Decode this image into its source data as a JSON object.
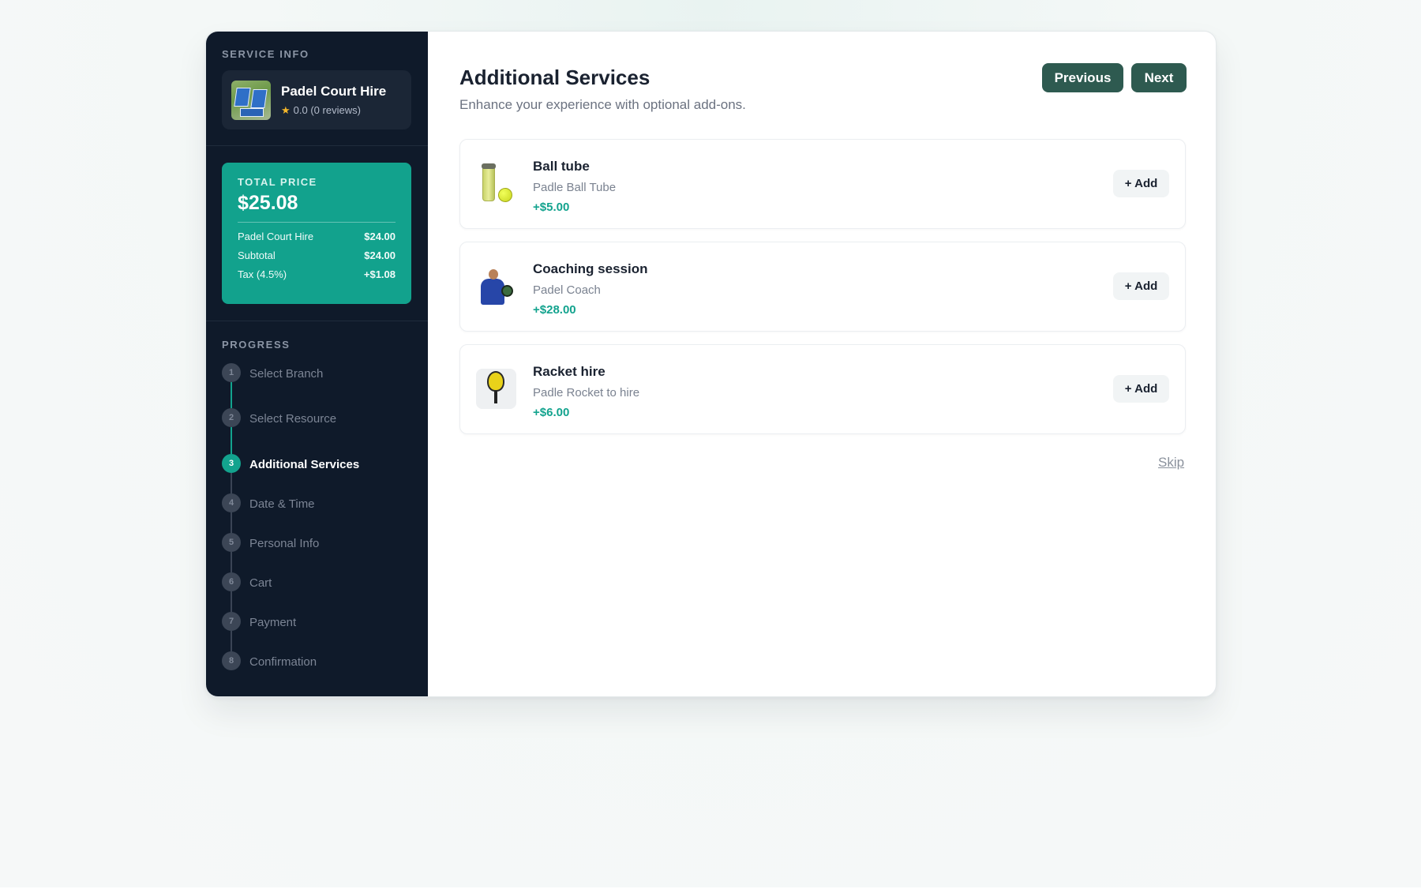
{
  "sidebar": {
    "service_info_label": "SERVICE INFO",
    "service": {
      "name": "Padel Court Hire",
      "rating_text": "0.0 (0 reviews)"
    },
    "price": {
      "label": "TOTAL PRICE",
      "total": "$25.08",
      "rows": [
        {
          "label": "Padel Court Hire",
          "value": "$24.00"
        },
        {
          "label": "Subtotal",
          "value": "$24.00"
        },
        {
          "label": "Tax (4.5%)",
          "value": "+$1.08"
        }
      ]
    },
    "progress_label": "PROGRESS",
    "steps": [
      {
        "num": "1",
        "label": "Select Branch"
      },
      {
        "num": "2",
        "label": "Select Resource"
      },
      {
        "num": "3",
        "label": "Additional Services"
      },
      {
        "num": "4",
        "label": "Date & Time"
      },
      {
        "num": "5",
        "label": "Personal Info"
      },
      {
        "num": "6",
        "label": "Cart"
      },
      {
        "num": "7",
        "label": "Payment"
      },
      {
        "num": "8",
        "label": "Confirmation"
      }
    ],
    "active_step": 3
  },
  "main": {
    "title": "Additional Services",
    "subtitle": "Enhance your experience with optional add-ons.",
    "previous_label": "Previous",
    "next_label": "Next",
    "addons": [
      {
        "name": "Ball tube",
        "description": "Padle Ball Tube",
        "price": "+$5.00",
        "add_label": "+ Add",
        "icon": "ball-tube-image"
      },
      {
        "name": "Coaching session",
        "description": "Padel Coach",
        "price": "+$28.00",
        "add_label": "+ Add",
        "icon": "coach-image"
      },
      {
        "name": "Racket hire",
        "description": "Padle Rocket to hire",
        "price": "+$6.00",
        "add_label": "+ Add",
        "icon": "racket-image"
      }
    ],
    "skip_label": "Skip"
  },
  "colors": {
    "sidebar_bg": "#0f1a2a",
    "accent": "#13a38e",
    "button_bg": "#2e5a50"
  }
}
